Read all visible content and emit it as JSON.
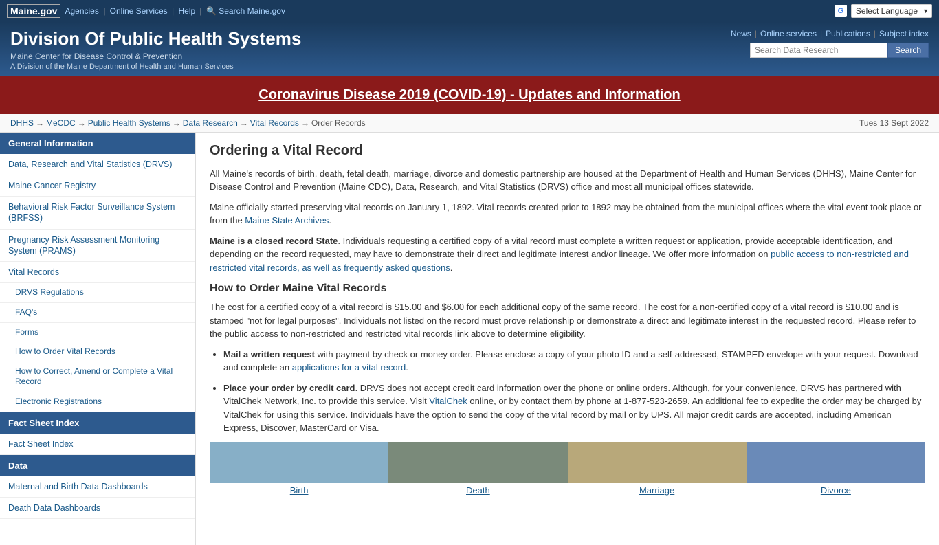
{
  "topbar": {
    "logo": "Maine.gov",
    "links": [
      "Agencies",
      "Online Services",
      "Help",
      "Search Maine.gov"
    ],
    "select_language": "Select Language"
  },
  "header": {
    "title": "Division Of Public Health Systems",
    "subtitle1": "Maine Center for Disease Control & Prevention",
    "subtitle2": "A Division of the Maine Department of Health and Human Services",
    "nav": {
      "news": "News",
      "online_services": "Online services",
      "publications": "Publications",
      "subject_index": "Subject index"
    },
    "search": {
      "placeholder": "Search Data Research",
      "button": "Search"
    }
  },
  "covid_banner": {
    "text": "Coronavirus Disease 2019 (COVID-19) - Updates and Information"
  },
  "breadcrumb": {
    "items": [
      "DHHS",
      "MeCDC",
      "Public Health Systems",
      "Data Research",
      "Vital Records",
      "Order Records"
    ],
    "separator": "→"
  },
  "date": "Tues 13 Sept 2022",
  "sidebar": {
    "sections": [
      {
        "header": "General Information",
        "items": [
          {
            "label": "Data, Research and Vital Statistics (DRVS)",
            "indent": false
          },
          {
            "label": "Maine Cancer Registry",
            "indent": false
          },
          {
            "label": "Behavioral Risk Factor Surveillance System (BRFSS)",
            "indent": false
          },
          {
            "label": "Pregnancy Risk Assessment Monitoring System (PRAMS)",
            "indent": false
          },
          {
            "label": "Vital Records",
            "indent": false
          },
          {
            "label": "DRVS Regulations",
            "indent": true
          },
          {
            "label": "FAQ's",
            "indent": true
          },
          {
            "label": "Forms",
            "indent": true
          },
          {
            "label": "How to Order Vital Records",
            "indent": true
          },
          {
            "label": "How to Correct, Amend or Complete a Vital Record",
            "indent": true
          },
          {
            "label": "Electronic Registrations",
            "indent": true
          }
        ]
      },
      {
        "header": "Fact Sheet Index",
        "items": [
          {
            "label": "Fact Sheet Index",
            "indent": false
          }
        ]
      },
      {
        "header": "Data",
        "items": [
          {
            "label": "Maternal and Birth Data Dashboards",
            "indent": false
          },
          {
            "label": "Death Data Dashboards",
            "indent": false
          }
        ]
      }
    ]
  },
  "content": {
    "page_title": "Ordering a Vital Record",
    "para1": "All Maine's records of birth, death, fetal death, marriage, divorce and domestic partnership are housed at the Department of Health and Human Services (DHHS), Maine Center for Disease Control and Prevention (Maine CDC), Data, Research, and Vital Statistics (DRVS) office and most all municipal offices statewide.",
    "para2": "Maine officially started preserving vital records on January 1, 1892. Vital records created prior to 1892 may be obtained from the municipal offices where the vital event took place or from the Maine State Archives.",
    "para3_bold": "Maine is a closed record State",
    "para3_rest": ". Individuals requesting a certified copy of a vital record must complete a written request or application, provide acceptable identification, and depending on the record requested, may have to demonstrate their direct and legitimate interest and/or lineage. We offer more information on public access to non-restricted and restricted vital records, as well as frequently asked questions.",
    "how_order_title": "How to Order Maine Vital Records",
    "para4": "The cost for a certified copy of a vital record is $15.00 and $6.00 for each additional copy of the same record. The cost for a non-certified copy of a vital record is $10.00 and is stamped \"not for legal purposes\". Individuals not listed on the record must prove relationship or demonstrate a direct and legitimate interest in the requested record. Please refer to the public access to non-restricted and restricted vital records link above to determine eligibility.",
    "bullet1_bold": "Mail a written request",
    "bullet1_rest": " with payment by check or money order. Please enclose a copy of your photo ID and a self-addressed, STAMPED envelope with your request. Download and complete an applications for a vital record.",
    "bullet2_bold": "Place your order by credit card",
    "bullet2_rest": ".  DRVS does not accept credit card information over the phone or online orders. Although, for your convenience, DRVS has partnered with VitalChek Network, Inc. to provide this service. Visit VitalChek online, or by contact them by phone at 1-877-523-2659. An additional fee to expedite the order may be charged by VitalChek for using this service. Individuals have the option to send the copy of the vital record by mail or by UPS. All major credit cards are accepted, including American Express, Discover, MasterCard or Visa.",
    "thumbnails": [
      {
        "label": "Birth",
        "type": "birth"
      },
      {
        "label": "Death",
        "type": "death"
      },
      {
        "label": "Marriage",
        "type": "marriage"
      },
      {
        "label": "Divorce",
        "type": "divorce"
      }
    ]
  }
}
